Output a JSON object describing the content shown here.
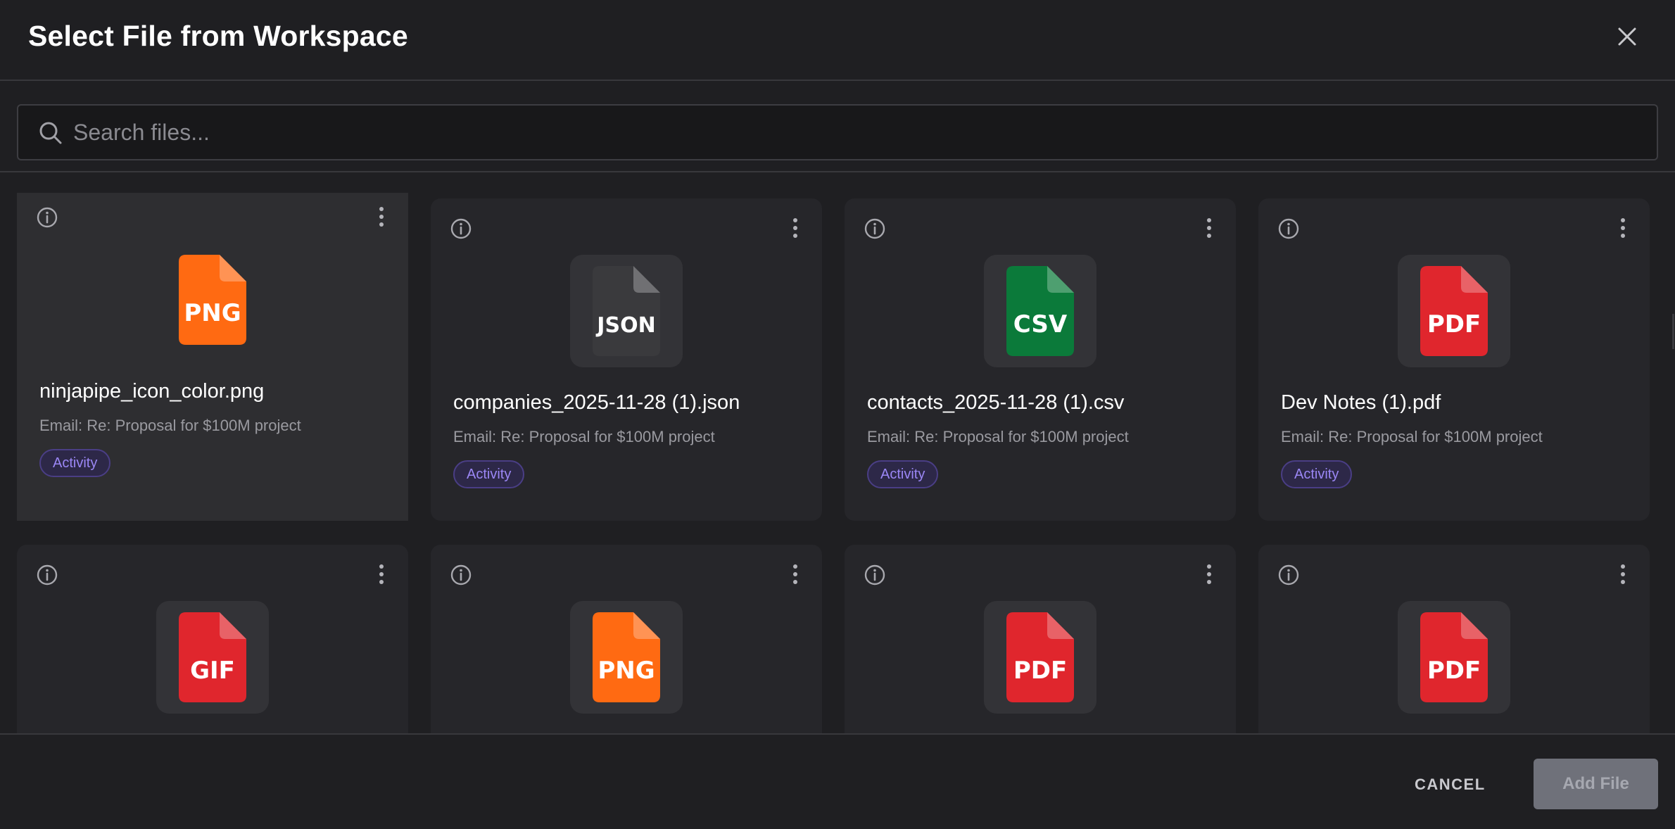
{
  "dialog": {
    "title": "Select File from Workspace",
    "close_icon": "close-icon"
  },
  "search": {
    "placeholder": "Search files...",
    "value": "",
    "icon": "search-icon"
  },
  "files": [
    {
      "name": "ninjapipe_icon_color.png",
      "type_label": "PNG",
      "source": "Email: Re: Proposal for $100M project",
      "tag": "Activity",
      "color": "#ff6a12",
      "selected": true
    },
    {
      "name": "companies_2025-11-28 (1).json",
      "type_label": "JSON",
      "source": "Email: Re: Proposal for $100M project",
      "tag": "Activity",
      "color": "#3a3a3d",
      "selected": false
    },
    {
      "name": "contacts_2025-11-28 (1).csv",
      "type_label": "CSV",
      "source": "Email: Re: Proposal for $100M project",
      "tag": "Activity",
      "color": "#0b7a3a",
      "selected": false
    },
    {
      "name": "Dev Notes (1).pdf",
      "type_label": "PDF",
      "source": "Email: Re: Proposal for $100M project",
      "tag": "Activity",
      "color": "#e0262d",
      "selected": false
    },
    {
      "name": "",
      "type_label": "GIF",
      "source": "",
      "tag": "",
      "color": "#e0262d",
      "selected": false
    },
    {
      "name": "",
      "type_label": "PNG",
      "source": "",
      "tag": "",
      "color": "#ff6a12",
      "selected": false
    },
    {
      "name": "",
      "type_label": "PDF",
      "source": "",
      "tag": "",
      "color": "#e0262d",
      "selected": false
    },
    {
      "name": "",
      "type_label": "PDF",
      "source": "",
      "tag": "",
      "color": "#e0262d",
      "selected": false
    }
  ],
  "card_icons": {
    "info": "info-icon",
    "more": "more-vertical-icon",
    "file": "file-icon"
  },
  "footer": {
    "cancel_label": "CANCEL",
    "add_label": "Add File",
    "add_disabled": true
  }
}
